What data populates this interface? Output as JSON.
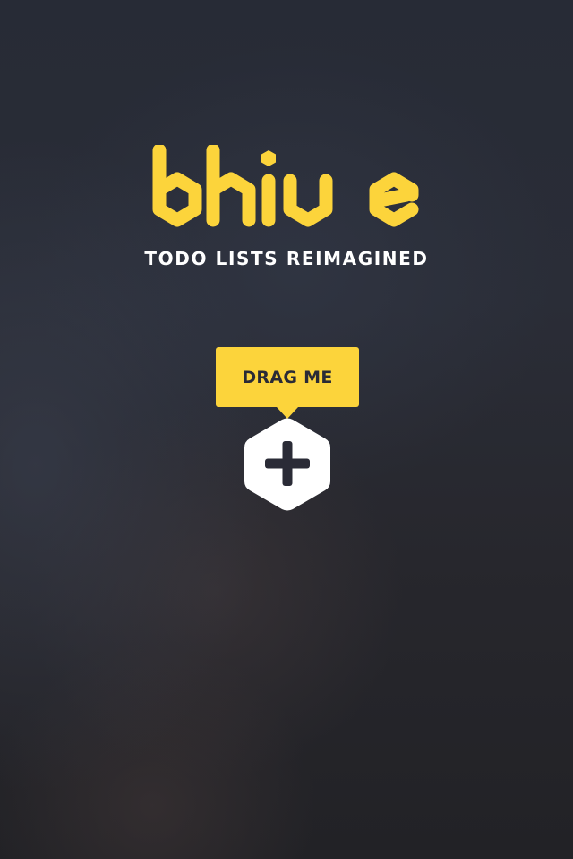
{
  "app": {
    "logo_text": "bhive",
    "tagline": "TODO LISTS REIMAGINED"
  },
  "onboarding": {
    "tooltip_label": "DRAG ME",
    "add_button_icon": "plus-icon"
  },
  "colors": {
    "accent": "#fcd43b",
    "hex_fill": "#ffffff",
    "icon_dark": "#2a2b36",
    "text_light": "#ffffff"
  }
}
